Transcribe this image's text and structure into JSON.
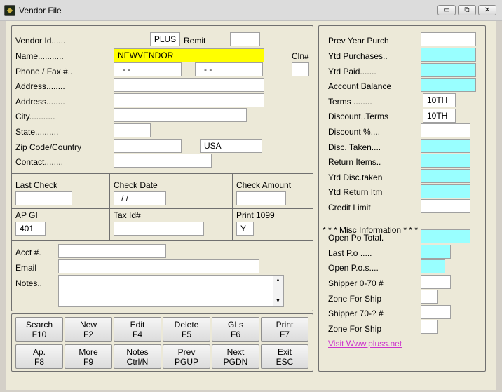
{
  "window": {
    "title": "Vendor File",
    "controls": {
      "minimize": "▭",
      "restore": "⧉",
      "close": "✕"
    }
  },
  "vendor": {
    "vendor_id_label": "Vendor Id......",
    "vendor_id_value": "PLUS",
    "remit_label": "Remit",
    "remit_value": "",
    "name_label": "Name...........",
    "name_value": "NEWVENDOR",
    "cln_label": "Cln#",
    "cln_value": "",
    "phone_fax_label": "Phone / Fax #..",
    "phone_value": "-   -",
    "fax_value": "-   -",
    "address1_label": "Address........",
    "address1_value": "",
    "address2_label": "Address........",
    "address2_value": "",
    "city_label": "City...........",
    "city_value": "",
    "state_label": "State..........",
    "state_value": "",
    "zip_label": "Zip Code/Country",
    "zip_value": "",
    "country_value": "USA",
    "contact_label": "Contact........",
    "contact_value": ""
  },
  "check": {
    "last_check_label": "Last Check",
    "last_check_value": "",
    "check_date_label": "Check Date",
    "check_date_value": "/ /",
    "check_amount_label": "Check Amount",
    "check_amount_value": ""
  },
  "ap": {
    "ap_gl_label": "AP GI",
    "ap_gl_value": "401",
    "tax_id_label": "Tax Id#",
    "tax_id_value": "",
    "print1099_label": "Print 1099",
    "print1099_value": "Y"
  },
  "misc_left": {
    "acct_label": "Acct #.",
    "acct_value": "",
    "email_label": "Email",
    "email_value": "",
    "notes_label": "Notes..",
    "notes_value": ""
  },
  "buttons": [
    {
      "label": "Search",
      "key": "F10"
    },
    {
      "label": "New",
      "key": "F2"
    },
    {
      "label": "Edit",
      "key": "F4"
    },
    {
      "label": "Delete",
      "key": "F5"
    },
    {
      "label": "GLs",
      "key": "F6"
    },
    {
      "label": "Print",
      "key": "F7"
    },
    {
      "label": "Ap.",
      "key": "F8"
    },
    {
      "label": "More",
      "key": "F9"
    },
    {
      "label": "Notes",
      "key": "Ctrl/N"
    },
    {
      "label": "Prev",
      "key": "PGUP"
    },
    {
      "label": "Next",
      "key": "PGDN"
    },
    {
      "label": "Exit",
      "key": "ESC"
    }
  ],
  "right": {
    "prev_year_purch_label": "Prev Year Purch",
    "prev_year_purch_value": "",
    "ytd_purchases_label": "Ytd Purchases..",
    "ytd_purchases_value": "",
    "ytd_paid_label": "Ytd Paid.......",
    "ytd_paid_value": "",
    "account_balance_label": "Account Balance",
    "account_balance_value": "",
    "terms_label": "Terms ........",
    "terms_value": "10TH",
    "discount_terms_label": "Discount..Terms",
    "discount_terms_value": "10TH",
    "discount_pct_label": "Discount %....",
    "discount_pct_value": "",
    "disc_taken_label": "Disc. Taken....",
    "disc_taken_value": "",
    "return_items_label": "Return Items..",
    "return_items_value": "",
    "ytd_disc_taken_label": "Ytd Disc.taken",
    "ytd_disc_taken_value": "",
    "ytd_return_itm_label": "Ytd Return Itm",
    "ytd_return_itm_value": "",
    "credit_limit_label": "Credit Limit",
    "credit_limit_value": "",
    "misc_header": "* * * Misc Information * * *",
    "open_po_total_label": "Open Po Total.",
    "open_po_total_value": "",
    "last_po_label": "Last P.o .....",
    "last_po_value": "",
    "open_pos_label": "Open P.o.s....",
    "open_pos_value": "",
    "shipper_0_70_label": "Shipper 0-70 #",
    "shipper_0_70_value": "",
    "zone_ship1_label": "Zone For Ship",
    "zone_ship1_value": "",
    "shipper_70_label": "Shipper 70-? #",
    "shipper_70_value": "",
    "zone_ship2_label": "Zone For Ship",
    "zone_ship2_value": "",
    "visit_link": "Visit Www.pluss.net"
  },
  "colors": {
    "cyan": "#99ffff",
    "yellow": "#ffff00",
    "link": "#cc33cc",
    "background": "#ece9d8"
  }
}
